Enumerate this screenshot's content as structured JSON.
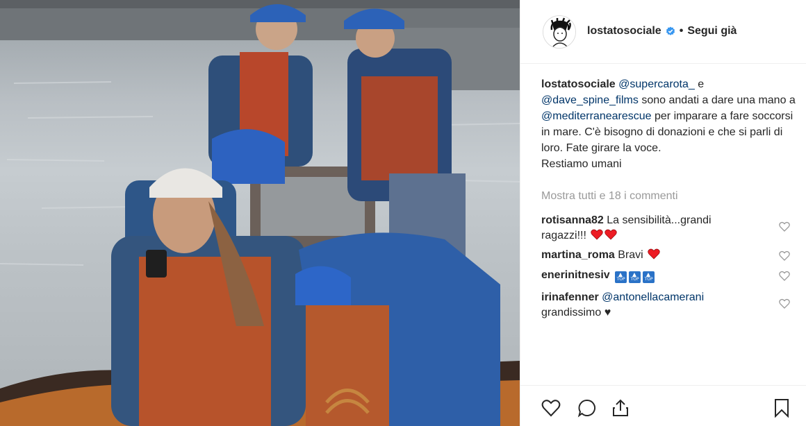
{
  "post": {
    "username": "lostatosociale",
    "separator": "•",
    "follow_label": "Segui già"
  },
  "caption": {
    "username": "lostatosociale",
    "mention_1": "@supercarota_",
    "text_1": " e",
    "mention_2": "@dave_spine_films",
    "text_2": " sono andati a dare una mano a ",
    "mention_3": "@mediterranearescue",
    "text_3": " per imparare a fare soccorsi in mare. C'è bisogno di donazioni e che si parli di loro. Fate girare la voce.",
    "line_last": "Restiamo umani"
  },
  "show_all_comments": "Mostra tutti e 18 i commenti",
  "comments": [
    {
      "user": "rotisanna82",
      "text": "La sensibilità...grandi ragazzi!!!",
      "emojis": [
        "red-heart",
        "red-heart"
      ]
    },
    {
      "user": "martina_roma",
      "text": "Bravi",
      "emojis": [
        "red-heart"
      ]
    },
    {
      "user": "enerinitnesiv",
      "text": "",
      "emojis": [
        "top-arrow",
        "top-arrow",
        "top-arrow"
      ]
    },
    {
      "user": "irinafenner",
      "mention": "@antonellacamerani",
      "text": "grandissimo ♥"
    }
  ],
  "emoji_labels": {
    "top": "TOP"
  },
  "icons": {
    "verified": "verified-badge-icon",
    "like": "heart-outline-icon",
    "comment": "comment-bubble-icon",
    "share": "share-icon",
    "save": "bookmark-icon"
  },
  "colors": {
    "mention": "#003569",
    "muted": "#999999",
    "verified": "#3897f0",
    "heart": "#ed4956"
  }
}
